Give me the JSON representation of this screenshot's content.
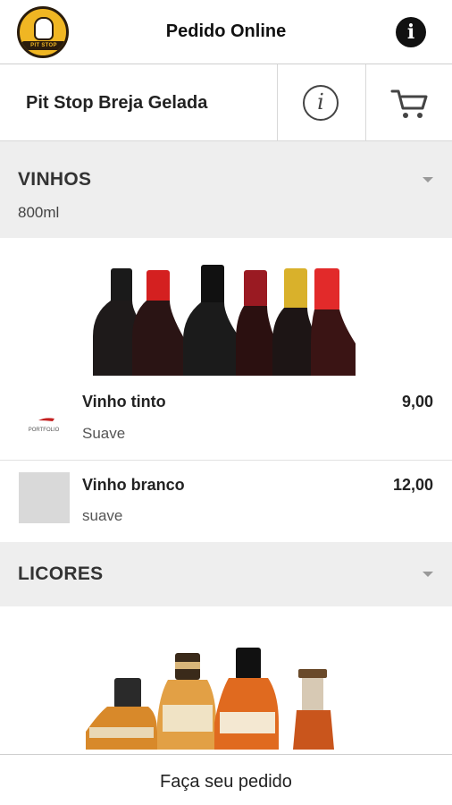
{
  "appbar": {
    "title": "Pedido Online",
    "logo_text": "PIT STOP BREJA",
    "info_icon": "info-filled-icon"
  },
  "store": {
    "name": "Pit Stop Breja Gelada",
    "info_icon": "info-outline-icon",
    "cart_icon": "cart-icon"
  },
  "categories": [
    {
      "title": "VINHOS",
      "subtitle": "800ml",
      "products": [
        {
          "name": "Vinho tinto",
          "description": "Suave",
          "price": "9,00",
          "thumb_text": "PORTFOLIO"
        },
        {
          "name": "Vinho branco",
          "description": "suave",
          "price": "12,00"
        }
      ]
    },
    {
      "title": "LICORES",
      "subtitle": ""
    }
  ],
  "footer": {
    "label": "Faça seu pedido"
  }
}
